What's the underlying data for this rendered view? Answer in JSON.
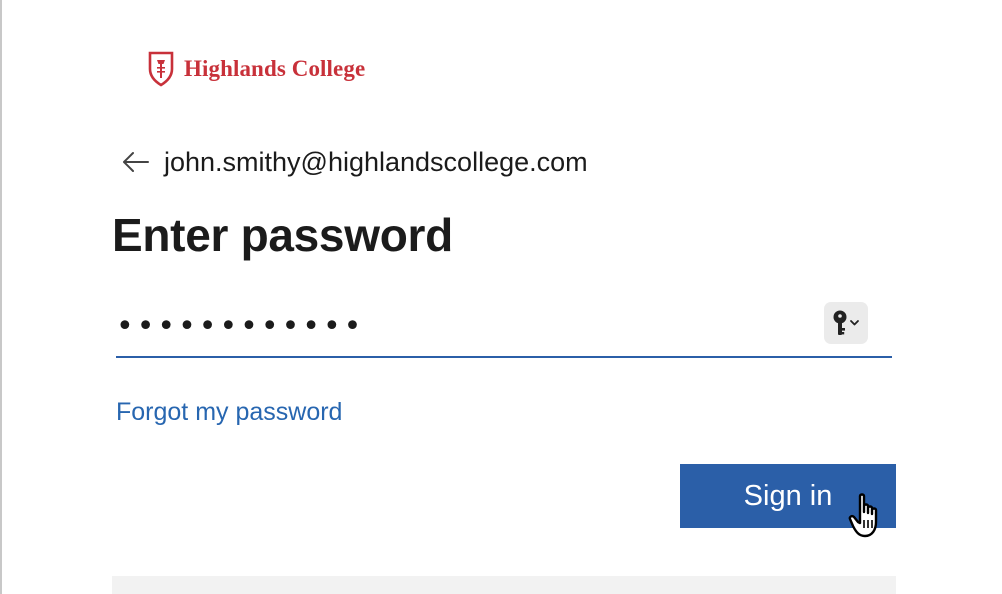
{
  "brand": {
    "name": "Highlands College",
    "color": "#c8313a",
    "icon": "shield-torch-icon"
  },
  "identity": {
    "back_icon": "arrow-left-icon",
    "email": "john.smithy@highlandscollege.com"
  },
  "heading": "Enter password",
  "password": {
    "value": "••••••••••••",
    "key_icon": "key-dropdown-icon"
  },
  "forgot_link": "Forgot my password",
  "signin_label": "Sign in",
  "colors": {
    "primary": "#2b5fa8",
    "link": "#2766b0",
    "text": "#1b1b1b"
  }
}
